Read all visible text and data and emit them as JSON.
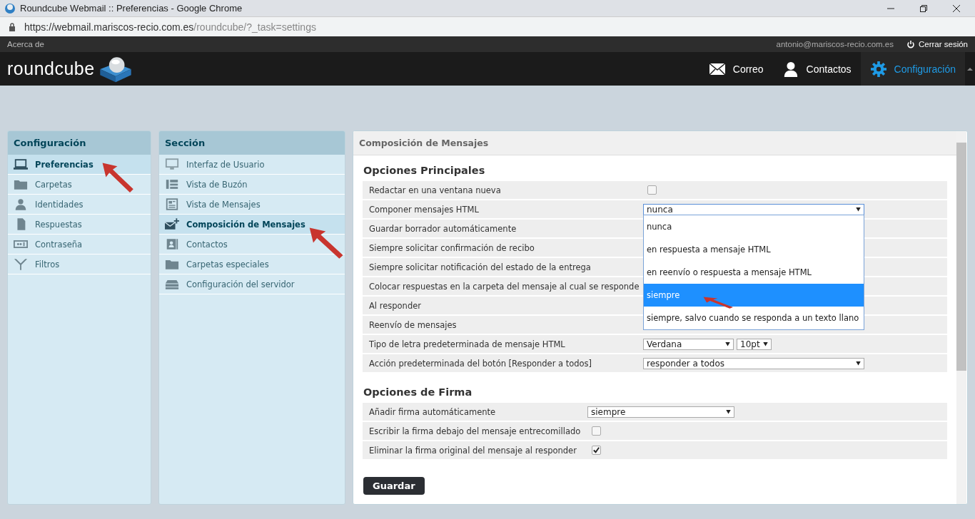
{
  "browser": {
    "title": "Roundcube Webmail :: Preferencias - Google Chrome",
    "url_host": "https://webmail.mariscos-recio.com.es",
    "url_path": "/roundcube/?_task=settings"
  },
  "topbar": {
    "about": "Acerca de",
    "user": "antonio@mariscos-recio.com.es",
    "logout": "Cerrar sesión"
  },
  "logo": "roundcube",
  "nav": [
    {
      "label": "Correo",
      "selected": false
    },
    {
      "label": "Contactos",
      "selected": false
    },
    {
      "label": "Configuración",
      "selected": true
    }
  ],
  "settings_panel": {
    "title": "Configuración",
    "items": [
      {
        "label": "Preferencias",
        "selected": true
      },
      {
        "label": "Carpetas",
        "selected": false
      },
      {
        "label": "Identidades",
        "selected": false
      },
      {
        "label": "Respuestas",
        "selected": false
      },
      {
        "label": "Contraseña",
        "selected": false
      },
      {
        "label": "Filtros",
        "selected": false
      }
    ]
  },
  "section_panel": {
    "title": "Sección",
    "items": [
      {
        "label": "Interfaz de Usuario",
        "selected": false
      },
      {
        "label": "Vista de Buzón",
        "selected": false
      },
      {
        "label": "Vista de Mensajes",
        "selected": false
      },
      {
        "label": "Composición de Mensajes",
        "selected": true
      },
      {
        "label": "Contactos",
        "selected": false
      },
      {
        "label": "Carpetas especiales",
        "selected": false
      },
      {
        "label": "Configuración del servidor",
        "selected": false
      }
    ]
  },
  "main": {
    "title": "Composición de Mensajes",
    "groups": [
      {
        "title": "Opciones Principales",
        "rows": [
          {
            "label": "Redactar en una ventana nueva",
            "kind": "checkbox",
            "checked": false
          },
          {
            "label": "Componer mensajes HTML",
            "kind": "select",
            "value": "nunca",
            "expanded": true
          },
          {
            "label": "Guardar borrador automáticamente",
            "kind": "hidden"
          },
          {
            "label": "Siempre solicitar confirmación de recibo",
            "kind": "hidden"
          },
          {
            "label": "Siempre solicitar notificación del estado de la entrega",
            "kind": "hidden"
          },
          {
            "label": "Colocar respuestas en la carpeta del mensaje al cual se responde",
            "kind": "hidden"
          },
          {
            "label": "Al responder",
            "kind": "hidden"
          },
          {
            "label": "Reenvío de mensajes",
            "kind": "hidden"
          },
          {
            "label": "Tipo de letra predeterminada de mensaje HTML",
            "kind": "font",
            "value": "Verdana",
            "size": "10pt"
          },
          {
            "label": "Acción predeterminada del botón [Responder a todos]",
            "kind": "select",
            "value": "responder a todos",
            "expanded": false
          }
        ]
      },
      {
        "title": "Opciones de Firma",
        "rows": [
          {
            "label": "Añadir firma automáticamente",
            "kind": "select",
            "value": "siempre",
            "expanded": false
          },
          {
            "label": "Escribir la firma debajo del mensaje entrecomillado",
            "kind": "checkbox",
            "checked": false
          },
          {
            "label": "Eliminar la firma original del mensaje al responder",
            "kind": "checkbox",
            "checked": true
          }
        ]
      }
    ],
    "dropdown": [
      {
        "label": "nunca",
        "selected": false
      },
      {
        "label": "en respuesta a mensaje HTML",
        "selected": false
      },
      {
        "label": "en reenvío o respuesta a mensaje HTML",
        "selected": false
      },
      {
        "label": "siempre",
        "selected": true
      },
      {
        "label": "siempre, salvo cuando se responda a un texto llano",
        "selected": false
      }
    ],
    "save": "Guardar"
  }
}
